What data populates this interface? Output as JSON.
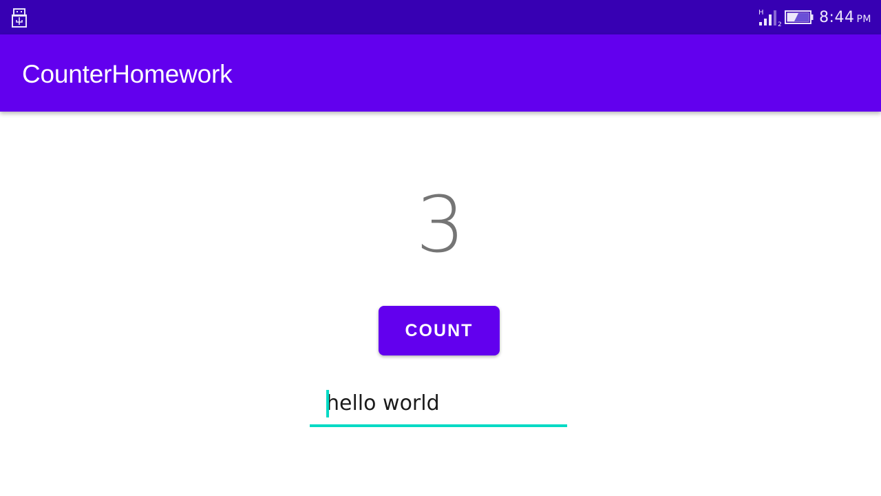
{
  "status_bar": {
    "left_icon": "usb-icon",
    "network_type": "H",
    "sim_slot": "2",
    "battery_icon": "battery-icon",
    "time": "8:44",
    "ampm": "PM"
  },
  "app_bar": {
    "title": "CounterHomework"
  },
  "main": {
    "count_value": "3",
    "count_button_label": "COUNT",
    "text_field_value": "hello world"
  },
  "colors": {
    "status_bar": "#3700b3",
    "primary": "#6200ee",
    "accent": "#03dac5",
    "counter_text": "#757575"
  }
}
